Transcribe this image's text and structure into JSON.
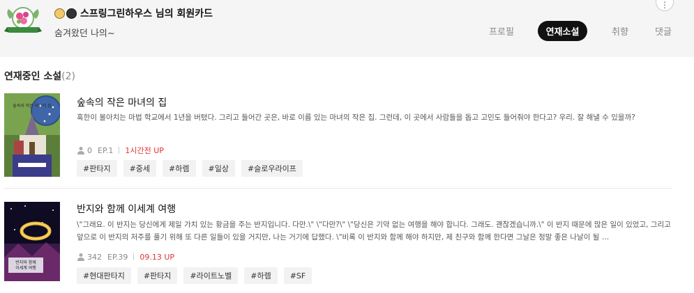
{
  "header": {
    "title": "스프링그린하우스 님의 회원카드",
    "subtitle": "숨겨왔던 나의~",
    "emojis": [
      "smiling-face-icon",
      "dark-hair-avatar-icon"
    ],
    "more_label": "⋮",
    "tabs": [
      {
        "label": "프로필",
        "active": false
      },
      {
        "label": "연재소설",
        "active": true
      },
      {
        "label": "취향",
        "active": false
      },
      {
        "label": "댓글",
        "active": false
      }
    ]
  },
  "section": {
    "title": "연재중인 소설",
    "count": "(2)"
  },
  "novels": [
    {
      "title": "숲속의 작은 마녀의 집",
      "description": "혹한이 몰아치는 마법 학교에서 1년을 버텼다.  그리고 들어간 곳은, 바로 이름 있는 마녀의 작은 집.  그런데, 이 곳에서 사람들을 돕고 고민도 들어줘야 한다고?  우리. 잘 해낼 수 있을까?",
      "readers": "0",
      "episode": "EP.1",
      "updated": "1시간전 UP",
      "tags": [
        "#판타지",
        "#중세",
        "#하렘",
        "#일상",
        "#슬로우라이프"
      ],
      "cover_text": "숲속의 작은 마녀의 집"
    },
    {
      "title": "반지와 함께 이세계 여행",
      "description": "\\\"그래요. 이 반지는 당신에게 제일 가치 있는 황금을 주는 반지입니다. 다만.\\\" \\\"다만?\\\" \\\"당신은 기약 없는 여행을 해야 합니다. 그래도. 괜찮겠습니까.\\\"  이 반지 때문에 많은 일이 있었고, 그리고 앞으로 이 반지의 저주를 풀기 위해 또 다른 일들이 있을 거지만, 나는 거기에 답했다.  \\\"비록 이 반지와 함께 해야 하지만, 제 친구와 함께 한다면 그날은 정말 좋은 나날이 될 …",
      "readers": "342",
      "episode": "EP.39",
      "updated": "09.13 UP",
      "tags": [
        "#현대판타지",
        "#판타지",
        "#라이트노벨",
        "#하렘",
        "#SF"
      ],
      "cover_text": "반지와 함께 이세계 여행"
    }
  ],
  "colors": {
    "header_bg": "#f5f5f5",
    "active_tab_bg": "#111111",
    "update_red": "#e03131",
    "tag_bg": "#f2f2f2"
  }
}
